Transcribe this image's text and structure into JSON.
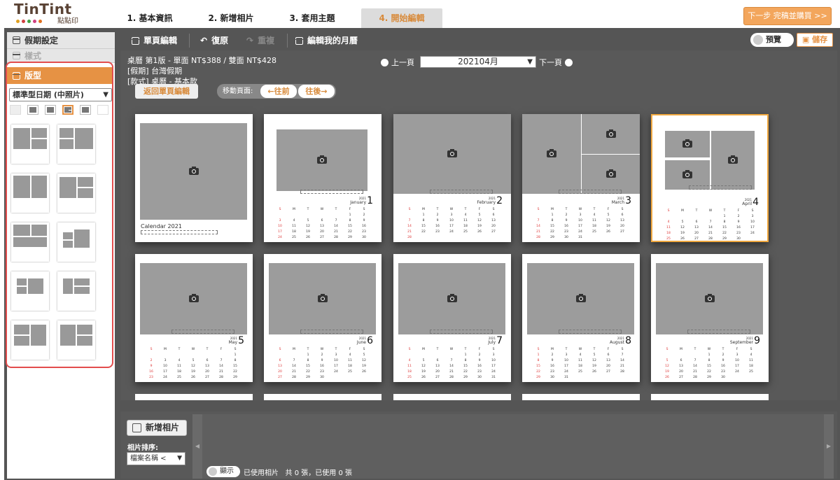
{
  "brand": {
    "name": "TinTint",
    "sub": "點點印",
    "dots": [
      "#e0a020",
      "#d04040",
      "#40a040",
      "#d04080",
      "#e07020"
    ]
  },
  "steps": [
    {
      "label": "1. 基本資訊"
    },
    {
      "label": "2. 新增相片"
    },
    {
      "label": "3. 套用主題"
    },
    {
      "label": "4. 開始編輯"
    }
  ],
  "next_label": "下一步 完稿並購買 >>",
  "sidebar": {
    "holiday": "假期設定",
    "style": "樣式",
    "layout": "版型",
    "layout_select": "標準型日期 (中照片)"
  },
  "toolbar": {
    "single": "單頁編輯",
    "undo": "復原",
    "redo": "重複",
    "edit_month": "編輯我的月曆",
    "preview": "預覽",
    "save": "儲存"
  },
  "info": {
    "line1": "桌曆 第1版 - 單面 NT$388 / 雙面 NT$428",
    "line2": "[假期] 台灣假期",
    "line3": "[款式] 桌曆 - 基本款"
  },
  "back_label": "返回單頁編輯",
  "move": {
    "label": "移動頁面:",
    "prev": "←往前",
    "next": "往後→"
  },
  "pagenav": {
    "prev": "上一頁",
    "next": "下一頁",
    "month": "202104月"
  },
  "cover_title": "Calendar 2021",
  "year": "2021",
  "months": [
    {
      "name": "January",
      "num": "1"
    },
    {
      "name": "February",
      "num": "2"
    },
    {
      "name": "March",
      "num": "3"
    },
    {
      "name": "April",
      "num": "4"
    },
    {
      "name": "May",
      "num": "5"
    },
    {
      "name": "June",
      "num": "6"
    },
    {
      "name": "July",
      "num": "7"
    },
    {
      "name": "August",
      "num": "8"
    },
    {
      "name": "September",
      "num": "9"
    }
  ],
  "dow": [
    "S",
    "M",
    "T",
    "W",
    "T",
    "F",
    "S"
  ],
  "bottom": {
    "add_photo": "新增相片",
    "sort_label": "相片排序:",
    "sort_value": "檔案名稱 <",
    "show": "顯示",
    "used": "已使用相片",
    "count": "共 0 張，已使用 0 張"
  },
  "colors": {
    "accent": "#e69244",
    "highlight": "#f0a840",
    "alert": "#e34d4d"
  }
}
